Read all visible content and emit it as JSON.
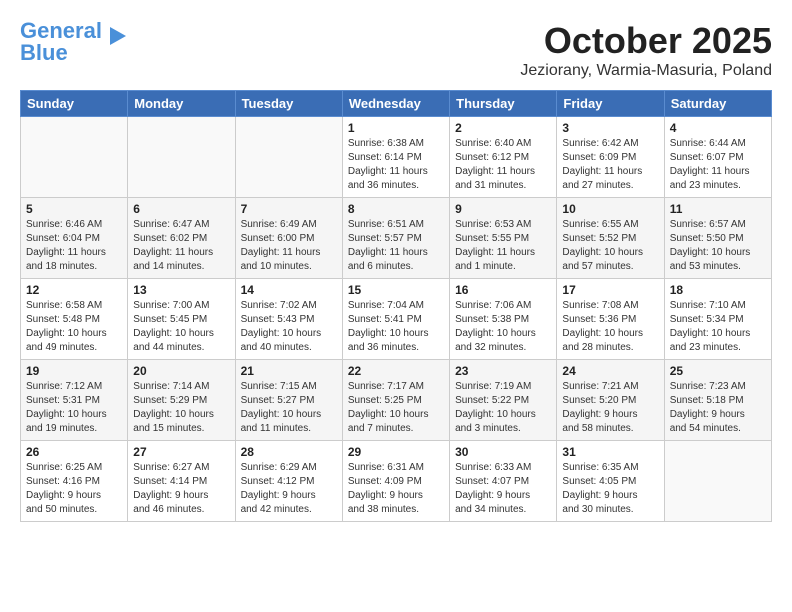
{
  "header": {
    "logo_line1": "General",
    "logo_line2": "Blue",
    "month_title": "October 2025",
    "location": "Jeziorany, Warmia-Masuria, Poland"
  },
  "weekdays": [
    "Sunday",
    "Monday",
    "Tuesday",
    "Wednesday",
    "Thursday",
    "Friday",
    "Saturday"
  ],
  "weeks": [
    [
      {
        "day": "",
        "info": ""
      },
      {
        "day": "",
        "info": ""
      },
      {
        "day": "",
        "info": ""
      },
      {
        "day": "1",
        "info": "Sunrise: 6:38 AM\nSunset: 6:14 PM\nDaylight: 11 hours\nand 36 minutes."
      },
      {
        "day": "2",
        "info": "Sunrise: 6:40 AM\nSunset: 6:12 PM\nDaylight: 11 hours\nand 31 minutes."
      },
      {
        "day": "3",
        "info": "Sunrise: 6:42 AM\nSunset: 6:09 PM\nDaylight: 11 hours\nand 27 minutes."
      },
      {
        "day": "4",
        "info": "Sunrise: 6:44 AM\nSunset: 6:07 PM\nDaylight: 11 hours\nand 23 minutes."
      }
    ],
    [
      {
        "day": "5",
        "info": "Sunrise: 6:46 AM\nSunset: 6:04 PM\nDaylight: 11 hours\nand 18 minutes."
      },
      {
        "day": "6",
        "info": "Sunrise: 6:47 AM\nSunset: 6:02 PM\nDaylight: 11 hours\nand 14 minutes."
      },
      {
        "day": "7",
        "info": "Sunrise: 6:49 AM\nSunset: 6:00 PM\nDaylight: 11 hours\nand 10 minutes."
      },
      {
        "day": "8",
        "info": "Sunrise: 6:51 AM\nSunset: 5:57 PM\nDaylight: 11 hours\nand 6 minutes."
      },
      {
        "day": "9",
        "info": "Sunrise: 6:53 AM\nSunset: 5:55 PM\nDaylight: 11 hours\nand 1 minute."
      },
      {
        "day": "10",
        "info": "Sunrise: 6:55 AM\nSunset: 5:52 PM\nDaylight: 10 hours\nand 57 minutes."
      },
      {
        "day": "11",
        "info": "Sunrise: 6:57 AM\nSunset: 5:50 PM\nDaylight: 10 hours\nand 53 minutes."
      }
    ],
    [
      {
        "day": "12",
        "info": "Sunrise: 6:58 AM\nSunset: 5:48 PM\nDaylight: 10 hours\nand 49 minutes."
      },
      {
        "day": "13",
        "info": "Sunrise: 7:00 AM\nSunset: 5:45 PM\nDaylight: 10 hours\nand 44 minutes."
      },
      {
        "day": "14",
        "info": "Sunrise: 7:02 AM\nSunset: 5:43 PM\nDaylight: 10 hours\nand 40 minutes."
      },
      {
        "day": "15",
        "info": "Sunrise: 7:04 AM\nSunset: 5:41 PM\nDaylight: 10 hours\nand 36 minutes."
      },
      {
        "day": "16",
        "info": "Sunrise: 7:06 AM\nSunset: 5:38 PM\nDaylight: 10 hours\nand 32 minutes."
      },
      {
        "day": "17",
        "info": "Sunrise: 7:08 AM\nSunset: 5:36 PM\nDaylight: 10 hours\nand 28 minutes."
      },
      {
        "day": "18",
        "info": "Sunrise: 7:10 AM\nSunset: 5:34 PM\nDaylight: 10 hours\nand 23 minutes."
      }
    ],
    [
      {
        "day": "19",
        "info": "Sunrise: 7:12 AM\nSunset: 5:31 PM\nDaylight: 10 hours\nand 19 minutes."
      },
      {
        "day": "20",
        "info": "Sunrise: 7:14 AM\nSunset: 5:29 PM\nDaylight: 10 hours\nand 15 minutes."
      },
      {
        "day": "21",
        "info": "Sunrise: 7:15 AM\nSunset: 5:27 PM\nDaylight: 10 hours\nand 11 minutes."
      },
      {
        "day": "22",
        "info": "Sunrise: 7:17 AM\nSunset: 5:25 PM\nDaylight: 10 hours\nand 7 minutes."
      },
      {
        "day": "23",
        "info": "Sunrise: 7:19 AM\nSunset: 5:22 PM\nDaylight: 10 hours\nand 3 minutes."
      },
      {
        "day": "24",
        "info": "Sunrise: 7:21 AM\nSunset: 5:20 PM\nDaylight: 9 hours\nand 58 minutes."
      },
      {
        "day": "25",
        "info": "Sunrise: 7:23 AM\nSunset: 5:18 PM\nDaylight: 9 hours\nand 54 minutes."
      }
    ],
    [
      {
        "day": "26",
        "info": "Sunrise: 6:25 AM\nSunset: 4:16 PM\nDaylight: 9 hours\nand 50 minutes."
      },
      {
        "day": "27",
        "info": "Sunrise: 6:27 AM\nSunset: 4:14 PM\nDaylight: 9 hours\nand 46 minutes."
      },
      {
        "day": "28",
        "info": "Sunrise: 6:29 AM\nSunset: 4:12 PM\nDaylight: 9 hours\nand 42 minutes."
      },
      {
        "day": "29",
        "info": "Sunrise: 6:31 AM\nSunset: 4:09 PM\nDaylight: 9 hours\nand 38 minutes."
      },
      {
        "day": "30",
        "info": "Sunrise: 6:33 AM\nSunset: 4:07 PM\nDaylight: 9 hours\nand 34 minutes."
      },
      {
        "day": "31",
        "info": "Sunrise: 6:35 AM\nSunset: 4:05 PM\nDaylight: 9 hours\nand 30 minutes."
      },
      {
        "day": "",
        "info": ""
      }
    ]
  ]
}
